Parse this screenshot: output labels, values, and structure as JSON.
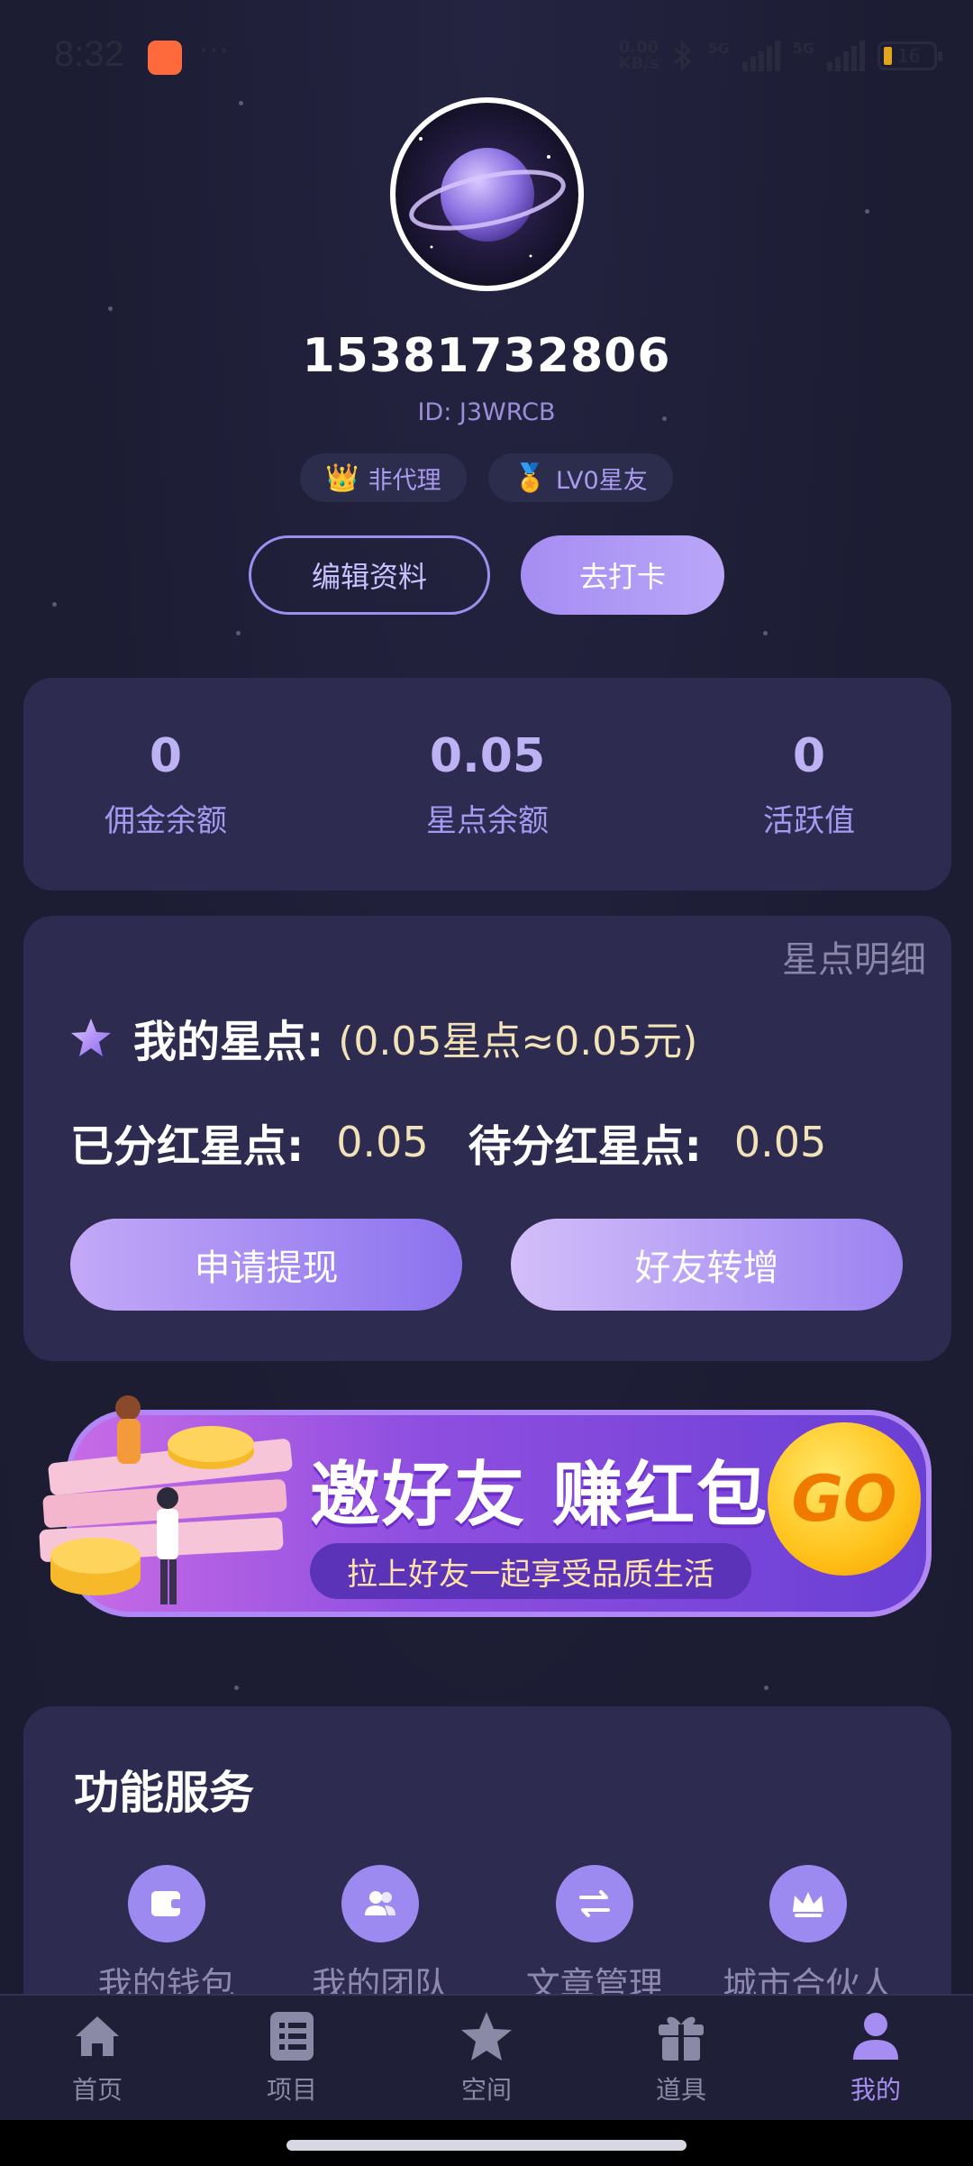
{
  "status_bar": {
    "time": "8:32",
    "more": "···",
    "net_speed_value": "0.00",
    "net_speed_unit": "KB/s",
    "signal1_label": "5G",
    "signal2_label": "5G",
    "battery": "16"
  },
  "profile": {
    "phone": "15381732806",
    "id": "ID: J3WRCB",
    "badge_agent": "非代理",
    "badge_level": "LV0星友",
    "edit_label": "编辑资料",
    "checkin_label": "去打卡"
  },
  "stats": [
    {
      "value": "0",
      "label": "佣金余额"
    },
    {
      "value": "0.05",
      "label": "星点余额"
    },
    {
      "value": "0",
      "label": "活跃值"
    }
  ],
  "points": {
    "detail_link": "星点明细",
    "title": "我的星点:",
    "subtitle": "(0.05星点≈0.05元)",
    "dividended_label": "已分红星点:",
    "dividended_value": "0.05",
    "pending_label": "待分红星点:",
    "pending_value": "0.05",
    "withdraw_label": "申请提现",
    "transfer_label": "好友转增"
  },
  "banner": {
    "title": "邀好友 赚红包",
    "subtitle": "拉上好友一起享受品质生活",
    "go": "GO"
  },
  "services": {
    "title": "功能服务",
    "items": [
      {
        "label": "我的钱包",
        "icon": "wallet-icon"
      },
      {
        "label": "我的团队",
        "icon": "team-icon"
      },
      {
        "label": "文章管理",
        "icon": "swap-icon"
      },
      {
        "label": "城市合伙人",
        "icon": "crown-icon"
      }
    ]
  },
  "nav": {
    "items": [
      {
        "label": "首页",
        "icon": "home-icon"
      },
      {
        "label": "项目",
        "icon": "list-icon"
      },
      {
        "label": "空间",
        "icon": "star-icon"
      },
      {
        "label": "道具",
        "icon": "gift-icon"
      },
      {
        "label": "我的",
        "icon": "user-icon",
        "active": true
      }
    ]
  },
  "colors": {
    "background": "#1c1c33",
    "card": "#2e2b50",
    "accent": "#a58df2",
    "gold_text": "#f1e2b8"
  }
}
